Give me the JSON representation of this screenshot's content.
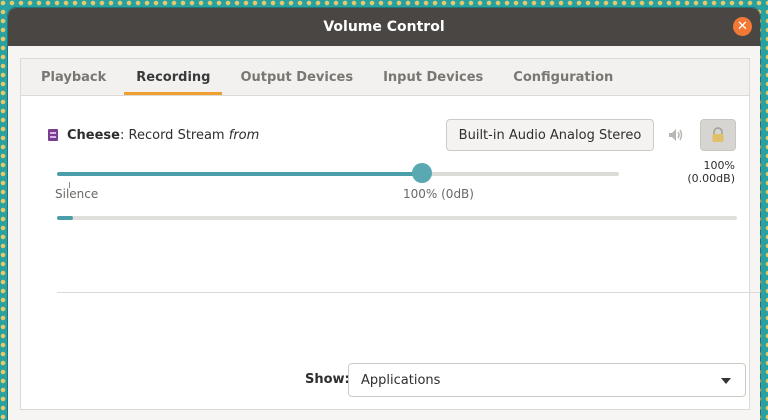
{
  "window": {
    "title": "Volume Control"
  },
  "tabs": [
    {
      "label": "Playback",
      "active": false
    },
    {
      "label": "Recording",
      "active": true
    },
    {
      "label": "Output Devices",
      "active": false
    },
    {
      "label": "Input Devices",
      "active": false
    },
    {
      "label": "Configuration",
      "active": false
    }
  ],
  "stream": {
    "app_name": "Cheese",
    "separator": ":",
    "stream_text": "Record Stream",
    "from_text": "from",
    "device": "Built-in Audio Analog Stereo",
    "volume_readout": "100% (0.00dB)",
    "volume_fraction": 0.65,
    "level_fraction": 0.023,
    "marks": {
      "silence": "Silence",
      "hundred": "100% (0dB)"
    },
    "icons": {
      "app": "cheese-app-icon",
      "mute": "speaker-icon",
      "lock": "lock-icon"
    }
  },
  "footer": {
    "show_label": "Show:",
    "show_value": "Applications"
  },
  "colors": {
    "accent": "#f0a030",
    "slider": "#4a9ea9",
    "close": "#f27835",
    "titlebar": "#4a4643"
  }
}
